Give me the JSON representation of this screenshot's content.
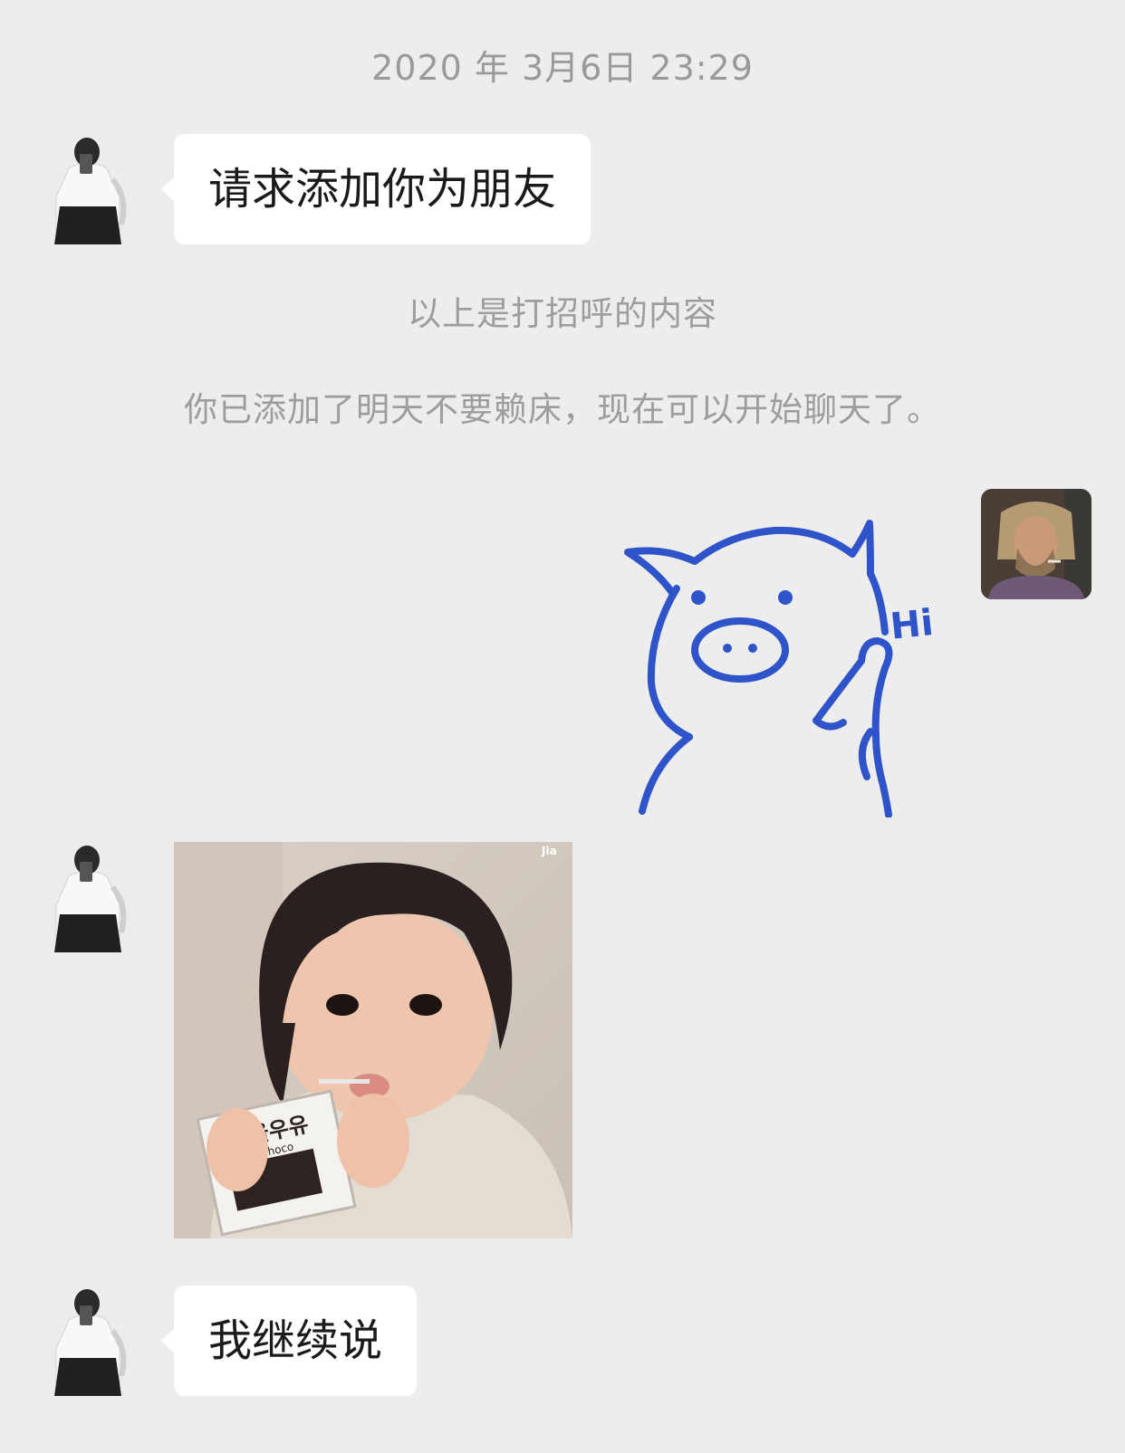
{
  "timestamp": "2020 年 3月6日 23:29",
  "messages": [
    {
      "from": "contact",
      "type": "text",
      "text": "请求添加你为朋友"
    },
    {
      "from": "me",
      "type": "sticker",
      "sticker_text": "Hi",
      "sticker_icon": "pig-waving-icon"
    },
    {
      "from": "contact",
      "type": "image",
      "watermark": "Jia",
      "carton_text": "서울우유",
      "carton_sub": "Choco"
    },
    {
      "from": "contact",
      "type": "text",
      "text": "我继续说"
    }
  ],
  "system": {
    "greeting_note": "以上是打招呼的内容",
    "added_note": "你已添加了明天不要赖床，现在可以开始聊天了。"
  },
  "colors": {
    "background": "#ededed",
    "bubble": "#ffffff",
    "system_text": "#9d9d9d",
    "sticker_ink": "#2f54c9"
  }
}
